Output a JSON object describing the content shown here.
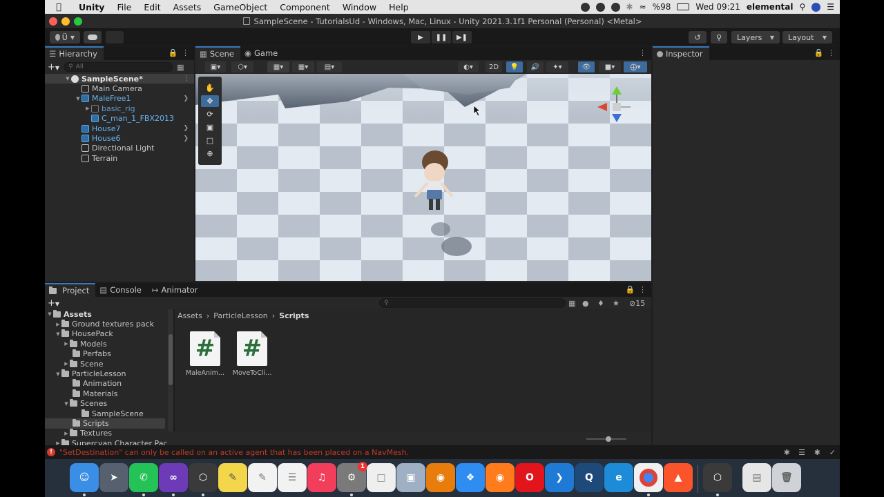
{
  "menubar": {
    "app": "Unity",
    "items": [
      "File",
      "Edit",
      "Assets",
      "GameObject",
      "Component",
      "Window",
      "Help"
    ],
    "battery": "%98",
    "clock": "Wed 09:21",
    "user": "elemental"
  },
  "window": {
    "title": "SampleScene - TutorialsUd - Windows, Mac, Linux - Unity 2021.3.1f1 Personal (Personal) <Metal>"
  },
  "toolbar": {
    "account_label": "Ü",
    "layers_label": "Layers",
    "layout_label": "Layout"
  },
  "hierarchy": {
    "tab_label": "Hierarchy",
    "search_placeholder": "All",
    "items": [
      {
        "label": "SampleScene*"
      },
      {
        "label": "Main Camera"
      },
      {
        "label": "MaleFree1"
      },
      {
        "label": "basic_rig"
      },
      {
        "label": "C_man_1_FBX2013"
      },
      {
        "label": "House7"
      },
      {
        "label": "House6"
      },
      {
        "label": "Directional Light"
      },
      {
        "label": "Terrain"
      }
    ]
  },
  "scene": {
    "tabs": [
      {
        "label": "Scene"
      },
      {
        "label": "Game"
      }
    ],
    "toggle_2d": "2D"
  },
  "inspector": {
    "tab_label": "Inspector"
  },
  "project": {
    "tabs": [
      {
        "label": "Project"
      },
      {
        "label": "Console"
      },
      {
        "label": "Animator"
      }
    ],
    "hidden_count": "15",
    "tree": [
      {
        "label": "Assets"
      },
      {
        "label": "Ground textures pack"
      },
      {
        "label": "HousePack"
      },
      {
        "label": "Models"
      },
      {
        "label": "Perfabs"
      },
      {
        "label": "Scene"
      },
      {
        "label": "ParticleLesson"
      },
      {
        "label": "Animation"
      },
      {
        "label": "Materials"
      },
      {
        "label": "Scenes"
      },
      {
        "label": "SampleScene"
      },
      {
        "label": "Scripts"
      },
      {
        "label": "Textures"
      },
      {
        "label": "Supercyan Character Pac"
      }
    ],
    "breadcrumb": [
      "Assets",
      "ParticleLesson",
      "Scripts"
    ],
    "assets": [
      {
        "label": "MaleAnim..."
      },
      {
        "label": "MoveToCli..."
      }
    ],
    "icon_size_fraction": 0.55
  },
  "status": {
    "message": "\"SetDestination\" can only be called on an active agent that has been placed on a NavMesh."
  },
  "dock": {
    "badge": "1"
  },
  "colors": {
    "accent": "#3a79bb",
    "error": "#d63b2f",
    "selected_object": "#67b6f5"
  }
}
